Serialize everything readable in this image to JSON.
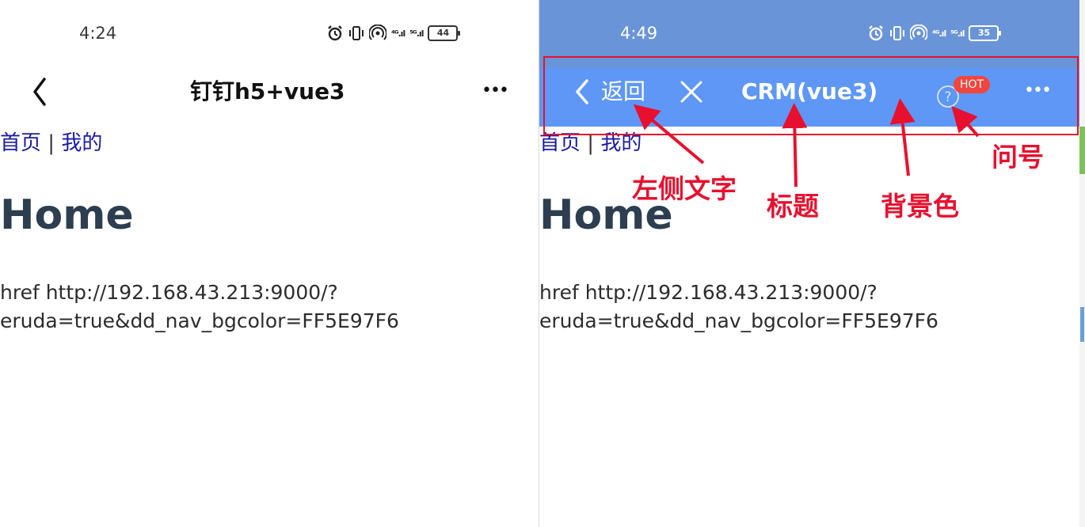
{
  "left": {
    "status": {
      "time": "4:24",
      "battery": "44",
      "signal1": "⁴ᴳ.ıl",
      "signal2": "⁵ᴳ.ıl"
    },
    "nav": {
      "title": "钉钉h5+vue3",
      "more": "•••"
    },
    "links": {
      "home": "首页",
      "sep": "|",
      "mine": "我的"
    },
    "heading": "Home",
    "href_line1": "href http://192.168.43.213:9000/?",
    "href_line2": "eruda=true&dd_nav_bgcolor=FF5E97F6"
  },
  "right": {
    "status": {
      "time": "4:49",
      "battery": "35",
      "signal1": "⁴ᴳ.ıl",
      "signal2": "⁵ᴳ.ıl"
    },
    "nav": {
      "back_label": "返回",
      "title": "CRM(vue3)",
      "badge": "HOT",
      "question": "?",
      "more": "•••",
      "background": "#5E97F6"
    },
    "links": {
      "home": "首页",
      "sep": "|",
      "mine": "我的"
    },
    "heading": "Home",
    "href_line1": "href http://192.168.43.213:9000/?",
    "href_line2": "eruda=true&dd_nav_bgcolor=FF5E97F6"
  },
  "annotations": {
    "left_text": "左侧文字",
    "title": "标题",
    "background": "背景色",
    "question": "问号"
  }
}
